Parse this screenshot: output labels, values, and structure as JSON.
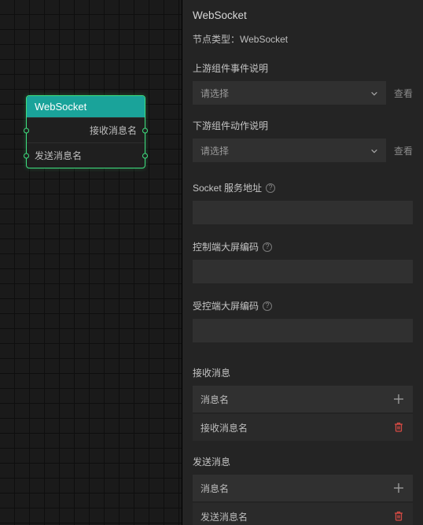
{
  "canvas": {
    "node": {
      "title": "WebSocket",
      "row1": "接收消息名",
      "row2": "发送消息名"
    }
  },
  "panel": {
    "title": "WebSocket",
    "node_type_label": "节点类型：WebSocket",
    "upstream": {
      "label": "上游组件事件说明",
      "placeholder": "请选择",
      "view": "查看"
    },
    "downstream": {
      "label": "下游组件动作说明",
      "placeholder": "请选择",
      "view": "查看"
    },
    "socket_addr_label": "Socket 服务地址",
    "control_code_label": "控制端大屏编码",
    "controlled_code_label": "受控端大屏编码",
    "recv": {
      "section_label": "接收消息",
      "column": "消息名",
      "item": "接收消息名"
    },
    "send": {
      "section_label": "发送消息",
      "column": "消息名",
      "item": "发送消息名"
    }
  }
}
